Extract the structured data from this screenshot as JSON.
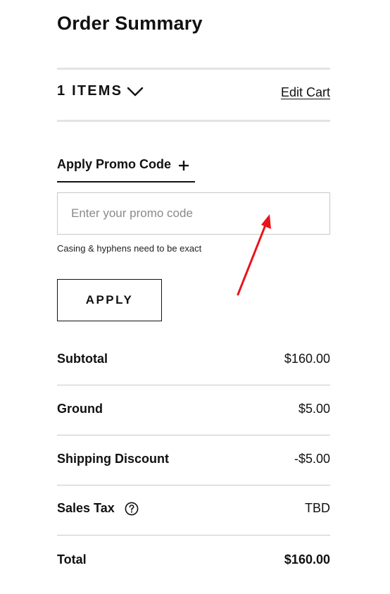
{
  "header": {
    "title": "Order Summary"
  },
  "cart": {
    "items_label": "1 ITEMS",
    "toggle_icon": "chevron-down-icon",
    "edit_label": "Edit Cart"
  },
  "promo": {
    "toggle_label": "Apply Promo Code",
    "toggle_icon": "plus-icon",
    "input_value": "",
    "placeholder": "Enter your promo code",
    "hint": "Casing & hyphens need to be exact",
    "apply_label": "APPLY"
  },
  "summary": {
    "rows": [
      {
        "label": "Subtotal",
        "value": "$160.00"
      },
      {
        "label": "Ground",
        "value": "$5.00"
      },
      {
        "label": "Shipping Discount",
        "value": "-$5.00"
      },
      {
        "label": "Sales Tax",
        "value": "TBD",
        "icon": "help-circle-icon"
      },
      {
        "label": "Total",
        "value": "$160.00"
      }
    ]
  },
  "annotation": {
    "arrow_color": "#e8141a"
  }
}
